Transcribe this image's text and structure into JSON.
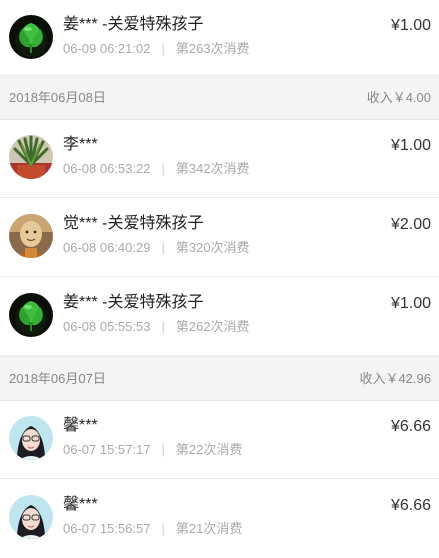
{
  "groups": [
    {
      "date": "",
      "total": "",
      "entries": [
        {
          "name": "姜*** -关爱特殊孩子",
          "time": "06-09 06:21:02",
          "count": "第263次消费",
          "amount": "¥1.00",
          "avatar": "leaf-icon"
        }
      ]
    },
    {
      "date": "2018年06月08日",
      "total": "收入￥4.00",
      "entries": [
        {
          "name": "李***",
          "time": "06-08 06:53:22",
          "count": "第342次消费",
          "amount": "¥1.00",
          "avatar": "plant-icon"
        },
        {
          "name": "觉*** -关爱特殊孩子",
          "time": "06-08 06:40:29",
          "count": "第320次消费",
          "amount": "¥2.00",
          "avatar": "monk-icon"
        },
        {
          "name": "姜*** -关爱特殊孩子",
          "time": "06-08 05:55:53",
          "count": "第262次消费",
          "amount": "¥1.00",
          "avatar": "leaf-icon"
        }
      ]
    },
    {
      "date": "2018年06月07日",
      "total": "收入￥42.96",
      "entries": [
        {
          "name": "馨***",
          "time": "06-07 15:57:17",
          "count": "第22次消费",
          "amount": "¥6.66",
          "avatar": "girl-icon"
        },
        {
          "name": "馨***",
          "time": "06-07 15:56:57",
          "count": "第21次消费",
          "amount": "¥6.66",
          "avatar": "girl-icon"
        }
      ]
    }
  ],
  "colors": {
    "text_primary": "#222222",
    "text_secondary": "#aaaaaa",
    "header_bg": "#f4f4f4",
    "leaf_green": "#3fbf3f"
  }
}
